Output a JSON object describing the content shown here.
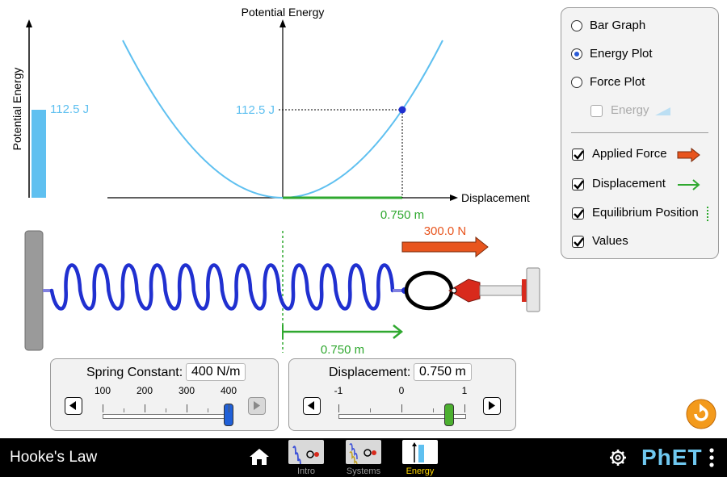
{
  "bar_graph": {
    "axis_label": "Potential Energy",
    "value_label": "112.5 J"
  },
  "energy_plot": {
    "y_axis_label": "Potential Energy",
    "x_axis_label": "Displacement",
    "y_value_label": "112.5 J",
    "x_value_label": "0.750 m"
  },
  "scene": {
    "applied_force_label": "300.0 N",
    "displacement_label": "0.750 m"
  },
  "spring_constant": {
    "title": "Spring Constant:",
    "value": "400 N/m",
    "ticks": [
      "100",
      "200",
      "300",
      "400"
    ],
    "level": 1.0
  },
  "displacement": {
    "title": "Displacement:",
    "value": "0.750 m",
    "ticks": [
      "-1",
      "0",
      "1"
    ],
    "level": 0.875
  },
  "options_panel": {
    "radios": [
      {
        "label": "Bar Graph",
        "selected": false
      },
      {
        "label": "Energy Plot",
        "selected": true
      },
      {
        "label": "Force Plot",
        "selected": false
      }
    ],
    "energy_checkbox": {
      "label": "Energy",
      "checked": false,
      "enabled": false
    },
    "checkboxes": [
      {
        "label": "Applied Force",
        "checked": true,
        "icon": "applied-force-arrow-icon"
      },
      {
        "label": "Displacement",
        "checked": true,
        "icon": "displacement-arrow-icon"
      },
      {
        "label": "Equilibrium Position",
        "checked": true,
        "icon": "equilibrium-line-icon"
      },
      {
        "label": "Values",
        "checked": true,
        "icon": ""
      }
    ]
  },
  "navbar": {
    "title": "Hooke's Law",
    "screens": [
      {
        "label": "Intro",
        "active": false
      },
      {
        "label": "Systems",
        "active": false
      },
      {
        "label": "Energy",
        "active": true
      }
    ],
    "brand": "PhET"
  },
  "colors": {
    "energy_blue": "#5fc0f0",
    "applied_force": "#e8551e",
    "displacement_green": "#2fa82f",
    "spring_blue": "#1f2fd1",
    "navbar_bg": "#000000",
    "active_screen": "#ffd700",
    "reset_orange": "#f39a1c"
  }
}
